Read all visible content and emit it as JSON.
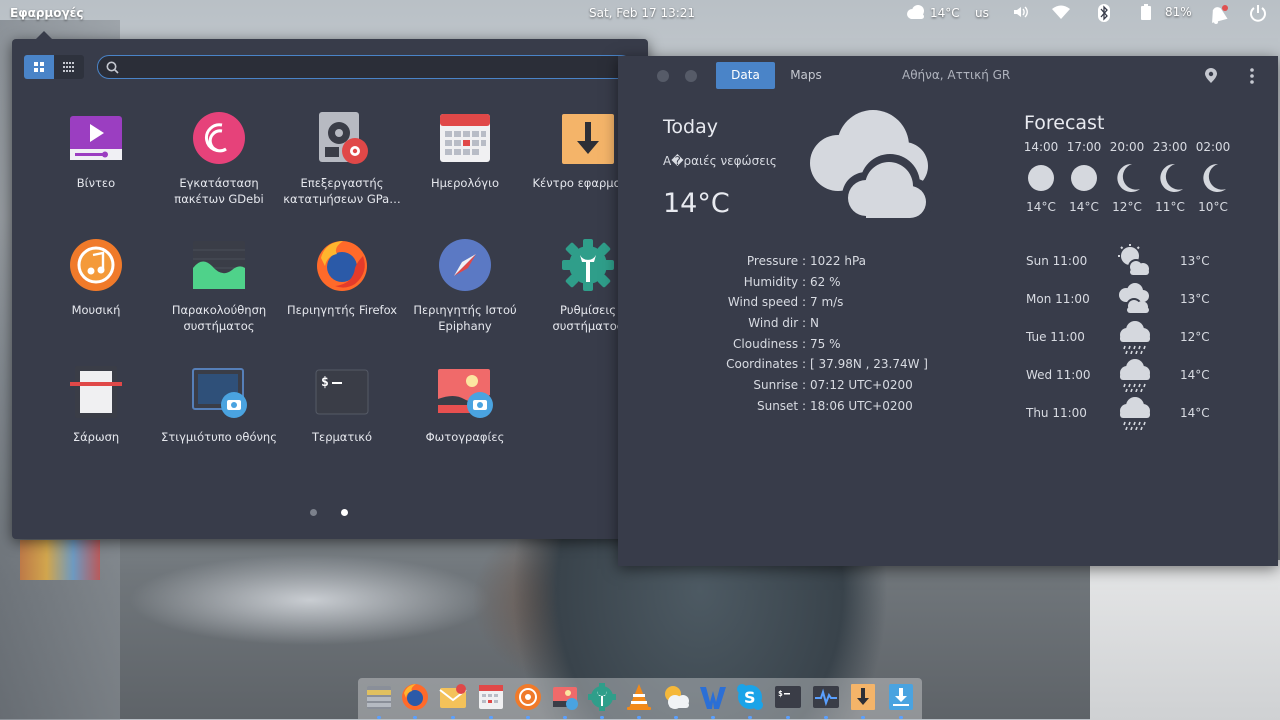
{
  "topbar": {
    "apps_label": "Εφαρμογές",
    "clock": "Sat, Feb 17   13:21",
    "weather_temp": "14°C",
    "keyboard_layout": "us",
    "battery": "81%"
  },
  "launcher": {
    "search_value": "",
    "apps": [
      {
        "label": "Βίντεο",
        "icon": "video-icon"
      },
      {
        "label": "Εγκατάσταση πακέτων GDebi",
        "icon": "gdebi-icon"
      },
      {
        "label": "Επεξεργαστής κατατμήσεων GPa…",
        "icon": "gparted-icon"
      },
      {
        "label": "Ημερολόγιο",
        "icon": "calendar-icon"
      },
      {
        "label": "Κέντρο εφαρμογών",
        "icon": "app-center-icon"
      },
      {
        "label": "Μουσική",
        "icon": "music-icon"
      },
      {
        "label": "Παρακολούθηση συστήματος",
        "icon": "system-monitor-icon"
      },
      {
        "label": "Περιηγητής Firefox",
        "icon": "firefox-icon"
      },
      {
        "label": "Περιηγητής Ιστού Epiphany",
        "icon": "epiphany-icon"
      },
      {
        "label": "Ρυθμίσεις συστήματος",
        "icon": "settings-icon"
      },
      {
        "label": "Σάρωση",
        "icon": "scanner-icon"
      },
      {
        "label": "Στιγμιότυπο οθόνης",
        "icon": "screenshot-icon"
      },
      {
        "label": "Τερματικό",
        "icon": "terminal-icon"
      },
      {
        "label": "Φωτογραφίες",
        "icon": "photos-icon"
      }
    ],
    "pages": 2,
    "current_page": 2
  },
  "weather": {
    "tabs": [
      {
        "label": "Data",
        "active": true
      },
      {
        "label": "Maps",
        "active": false
      }
    ],
    "location": "Αθήνα, Αττική GR",
    "today_title": "Today",
    "description": "Α�ραιές νεφώσεις",
    "temperature": "14°C",
    "details": [
      {
        "key": "Pressure :",
        "value": "1022 hPa"
      },
      {
        "key": "Humidity :",
        "value": "62 %"
      },
      {
        "key": "Wind speed :",
        "value": "7 m/s"
      },
      {
        "key": "Wind dir :",
        "value": "N"
      },
      {
        "key": "Cloudiness :",
        "value": "75 %"
      },
      {
        "key": "Coordinates :",
        "value": "[ 37.98N , 23.74W ]"
      },
      {
        "key": "Sunrise :",
        "value": "07:12 UTC+0200"
      },
      {
        "key": "Sunset :",
        "value": "18:06 UTC+0200"
      }
    ],
    "forecast_title": "Forecast",
    "hourly": [
      {
        "time": "14:00",
        "temp": "14°C",
        "icon": "sun-icon"
      },
      {
        "time": "17:00",
        "temp": "14°C",
        "icon": "sun-icon"
      },
      {
        "time": "20:00",
        "temp": "12°C",
        "icon": "moon-icon"
      },
      {
        "time": "23:00",
        "temp": "11°C",
        "icon": "moon-icon"
      },
      {
        "time": "02:00",
        "temp": "10°C",
        "icon": "moon-icon"
      }
    ],
    "daily": [
      {
        "day": "Sun 11:00",
        "temp": "13°C",
        "icon": "sun-cloud-icon"
      },
      {
        "day": "Mon 11:00",
        "temp": "13°C",
        "icon": "clouds-icon"
      },
      {
        "day": "Tue 11:00",
        "temp": "12°C",
        "icon": "rain-icon"
      },
      {
        "day": "Wed 11:00",
        "temp": "14°C",
        "icon": "rain-icon"
      },
      {
        "day": "Thu 11:00",
        "temp": "14°C",
        "icon": "rain-icon"
      }
    ]
  },
  "dock": {
    "items": [
      "files-icon",
      "firefox-icon",
      "mail-icon",
      "calendar-icon",
      "music-icon",
      "photos-icon",
      "settings-icon",
      "vlc-icon",
      "weather-icon",
      "writer-icon",
      "skype-icon",
      "terminal-icon",
      "system-monitor-icon",
      "app-center-icon",
      "downloader-icon"
    ]
  },
  "colors": {
    "accent": "#4a84c8",
    "panel": "#383c4a"
  }
}
